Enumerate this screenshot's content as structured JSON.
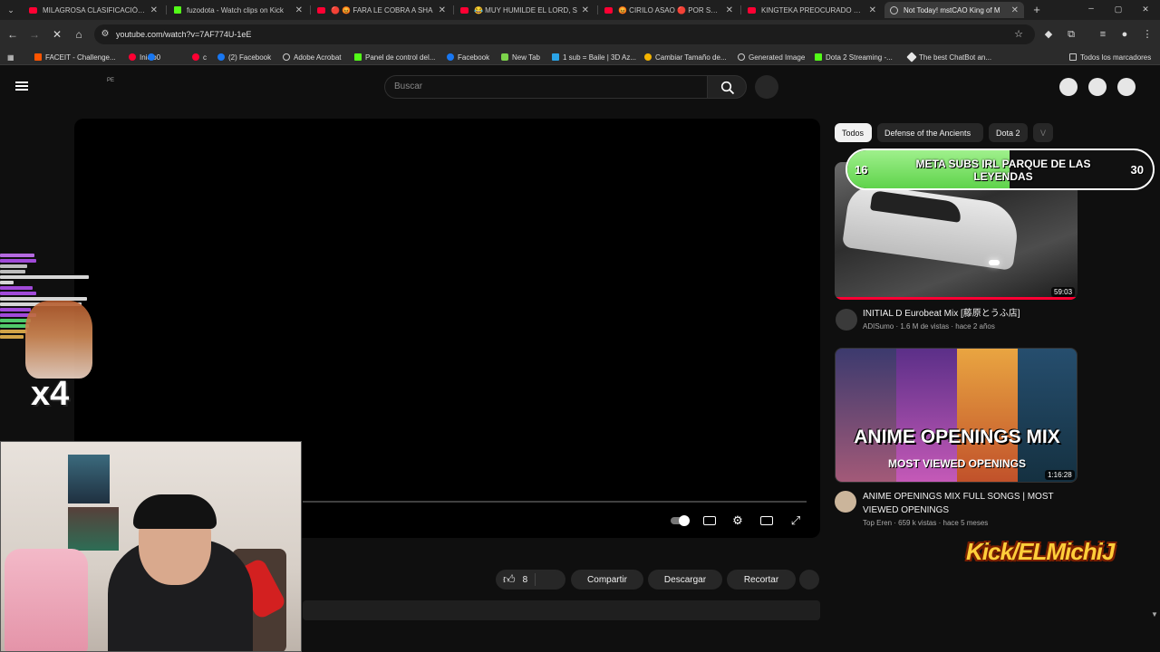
{
  "browser": {
    "tabs": [
      {
        "title": "MILAGROSA CLASIFICACIÓN D",
        "icon": "youtube-icon",
        "active": false
      },
      {
        "title": "fuzodota - Watch clips on Kick",
        "icon": "kick-icon",
        "active": false
      },
      {
        "title": "🔴 😡 FARA LE COBRA A SHA",
        "icon": "youtube-icon",
        "active": false
      },
      {
        "title": "😂 MUY HUMILDE EL LORD, S",
        "icon": "youtube-icon",
        "active": false
      },
      {
        "title": "😡 CIRILO ASAO 🔴 POR SUS GA",
        "icon": "youtube-icon",
        "active": false
      },
      {
        "title": "KINGTEKA PREOCURADO POR",
        "icon": "youtube-icon",
        "active": false
      },
      {
        "title": "Not Today! mstCAO King of M",
        "icon": "globe-icon",
        "active": true
      }
    ],
    "url": "youtube.com/watch?v=7AF774U-1eE",
    "bookmarks": [
      {
        "label": "FACEIT - Challenge..."
      },
      {
        "label": "Inicio0"
      },
      {
        "label": "c"
      },
      {
        "label": "(2) Facebook"
      },
      {
        "label": "Adobe Acrobat"
      },
      {
        "label": "Panel de control del..."
      },
      {
        "label": "Facebook"
      },
      {
        "label": "New Tab"
      },
      {
        "label": "1 sub = Baile | 3D Az..."
      },
      {
        "label": "Cambiar Tamaño de..."
      },
      {
        "label": "Generated Image"
      },
      {
        "label": "Dota 2 Streaming -..."
      },
      {
        "label": "The best ChatBot an..."
      }
    ],
    "all_bookmarks": "Todos los marcadores"
  },
  "youtube": {
    "country": "PE",
    "search_placeholder": "Buscar",
    "actions": {
      "likes": "8",
      "share": "Compartir",
      "download": "Descargar",
      "clip": "Recortar"
    },
    "chips": [
      "Todos",
      "Defense of the Ancients",
      "Dota 2",
      "V"
    ],
    "videos": [
      {
        "title": "INITIAL D Eurobeat Mix [藤原とうふ店]",
        "channel": "ADISumo",
        "stats": "1.6 M de vistas · hace 2 años",
        "duration": "59:03"
      },
      {
        "title": "ANIME OPENINGS MIX FULL SONGS | MOST VIEWED OPENINGS",
        "channel": "Top Eren",
        "stats": "659 k vistas · hace 5 meses",
        "duration": "1:16:28",
        "thumb_text_1": "ANIME OPENINGS MIX",
        "thumb_text_2": "MOST VIEWED OPENINGS"
      }
    ]
  },
  "overlay": {
    "goal_text": "META SUBS IRL PARQUE DE LAS LEYENDAS",
    "goal_current": "16",
    "goal_target": "30",
    "goal_progress": 0.53,
    "multiplier": "x4",
    "kick_handle": "Kick/ELMichiJ"
  },
  "colors": {
    "youtube_red": "#ff0033",
    "kick_green": "#53fc18",
    "goal_green": "#5fd34b"
  }
}
